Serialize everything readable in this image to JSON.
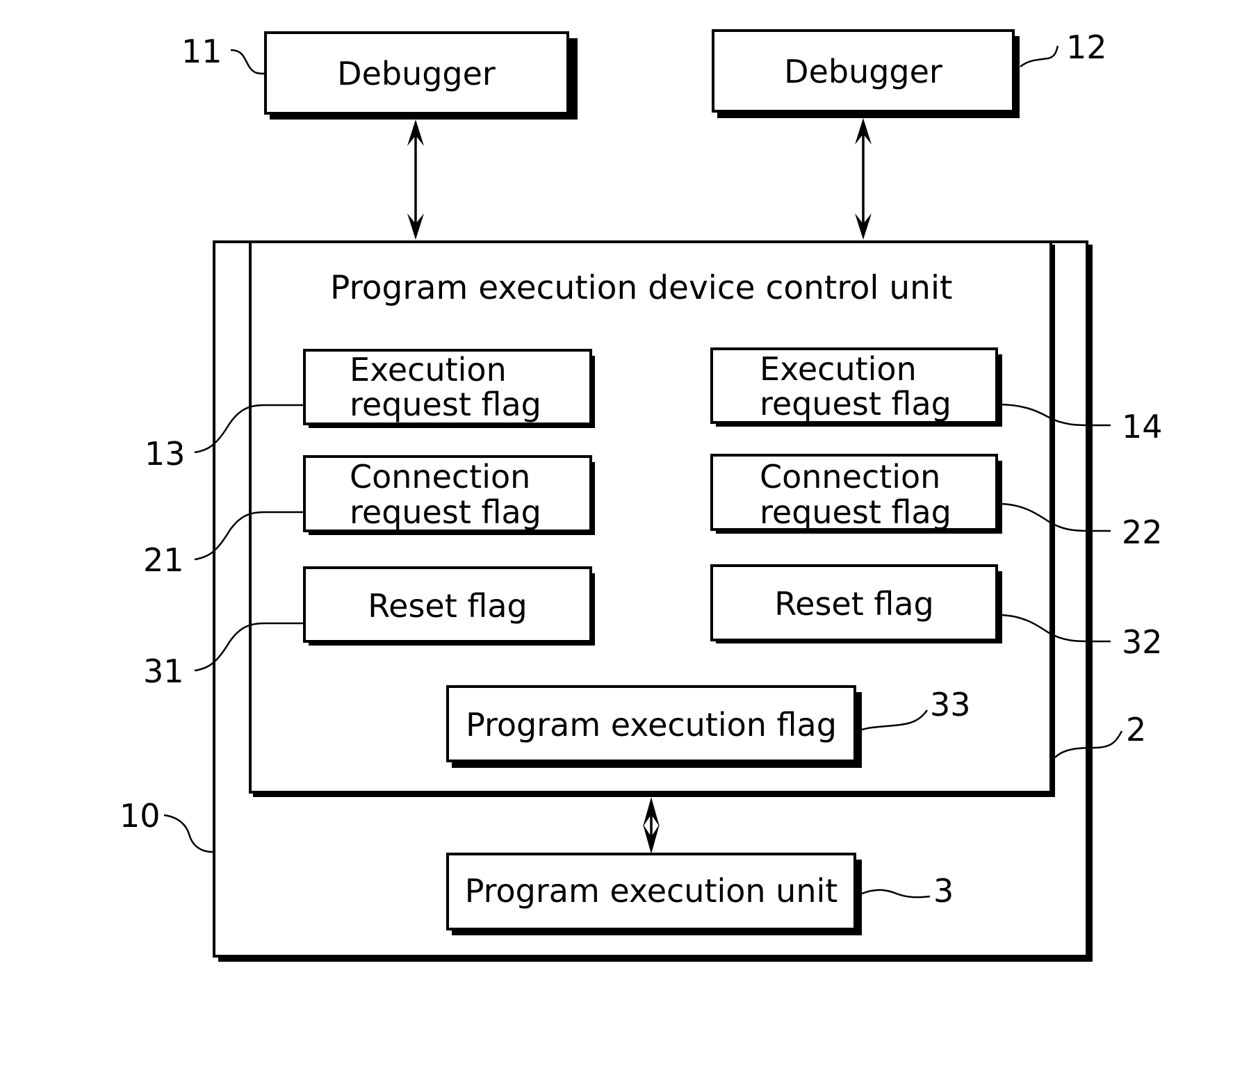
{
  "figure": {
    "debuggers": [
      {
        "label": "Debugger",
        "ref": "11"
      },
      {
        "label": "Debugger",
        "ref": "12"
      }
    ],
    "device": {
      "ref": "10"
    },
    "control_unit": {
      "title": "Program execution device control unit",
      "ref": "2",
      "flags": {
        "exec_req_1": {
          "line1": "Execution",
          "line2": "request flag",
          "ref": "13"
        },
        "exec_req_2": {
          "line1": "Execution",
          "line2": "request flag",
          "ref": "14"
        },
        "conn_req_1": {
          "line1": "Connection",
          "line2": "request flag",
          "ref": "21"
        },
        "conn_req_2": {
          "line1": "Connection",
          "line2": "request flag",
          "ref": "22"
        },
        "reset_1": {
          "label": "Reset flag",
          "ref": "31"
        },
        "reset_2": {
          "label": "Reset flag",
          "ref": "32"
        },
        "program_exec": {
          "label": "Program execution flag",
          "ref": "33"
        }
      }
    },
    "execution_unit": {
      "label": "Program execution unit",
      "ref": "3"
    }
  }
}
